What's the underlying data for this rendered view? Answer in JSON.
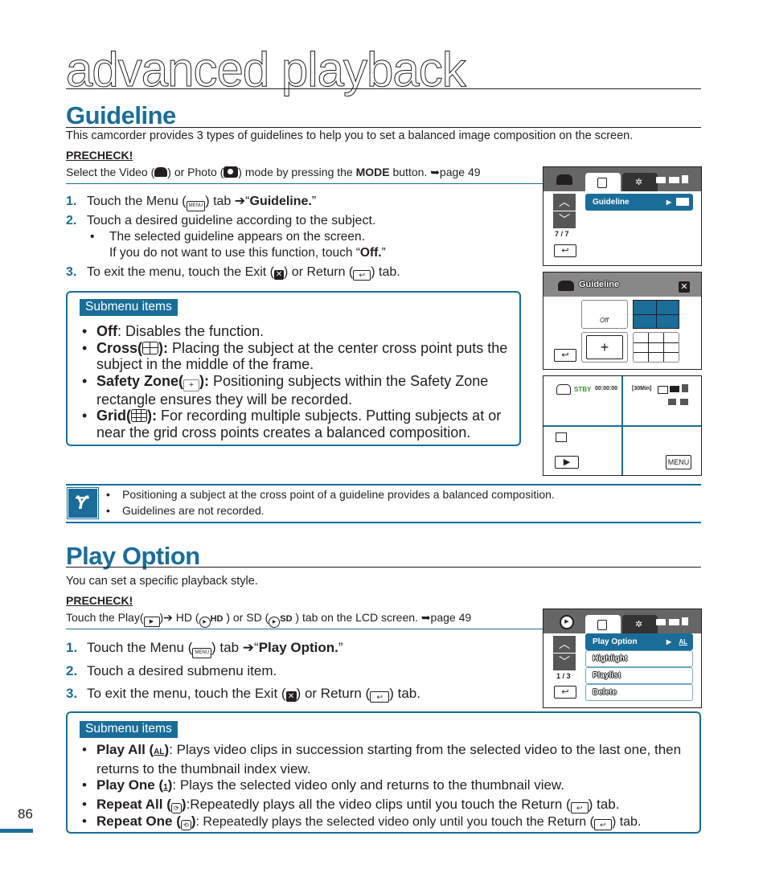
{
  "chapter": {
    "title": "advanced playback",
    "page_number": "86"
  },
  "colors": {
    "accent": "#1a6d99",
    "text": "#231f20",
    "stby_green": "#3a8f2e"
  },
  "guideline": {
    "title": "Guideline",
    "intro": "This camcorder provides 3 types of guidelines to help you to set a balanced image composition on the screen.",
    "precheck_label": "PRECHECK!",
    "precheck_text_1": "Select the Video (",
    "precheck_text_2": ") or Photo (",
    "precheck_text_3": ") mode by pressing the ",
    "precheck_mode": "MODE",
    "precheck_text_4": " button. ",
    "precheck_page": "➥page 49",
    "steps": [
      {
        "num": "1.",
        "pre": "Touch the Menu (",
        "icon": "MENU",
        "mid": ") tab ➔“",
        "bold": "Guideline.",
        "post": "”"
      },
      {
        "num": "2.",
        "text": "Touch a desired guideline according to the subject."
      },
      {
        "num": "3.",
        "pre": "To exit the menu, touch the Exit (",
        "mid": ") or Return (",
        "post": ") tab."
      }
    ],
    "step2_bullet_1": "The selected guideline appears on the screen.",
    "step2_bullet_2_pre": "If you do not want to use this function, touch “",
    "step2_bullet_2_bold": "Off.",
    "step2_bullet_2_post": "”",
    "submenu_label": "Submenu items",
    "submenu": [
      {
        "name": "Off",
        "desc": ": Disables the function."
      },
      {
        "name": "Cross(",
        "name_end": "):",
        "desc": " Placing the subject at the center cross point puts the subject in the middle of the frame."
      },
      {
        "name": "Safety Zone(",
        "name_end": "):",
        "desc": " Positioning subjects within the Safety Zone rectangle ensures they will be recorded."
      },
      {
        "name": "Grid(",
        "name_end": "):",
        "desc": " For recording multiple subjects. Putting subjects at or near the grid cross points creates a balanced composition."
      }
    ],
    "notes": [
      "Positioning a subject at the cross point of a guideline provides a balanced composition.",
      "Guidelines are not recorded."
    ],
    "screen1": {
      "menu_item": "Guideline",
      "page": "7 / 7"
    },
    "screen2": {
      "title": "Guideline",
      "off_label": "Off"
    },
    "screen3": {
      "stby": "STBY",
      "time": "00:00:00",
      "remaining": "[30Min]",
      "menu_button": "MENU"
    }
  },
  "play_option": {
    "title": "Play Option",
    "intro": "You can set a specific playback style.",
    "precheck_label": "PRECHECK!",
    "precheck_text_1": "Touch the Play(",
    "precheck_text_2": ")➔ HD (",
    "precheck_hd": "HD",
    "precheck_text_3": " ) or SD (",
    "precheck_sd": "SD",
    "precheck_text_4": " ) tab on the LCD screen. ",
    "precheck_page": "➥page 49",
    "steps": [
      {
        "num": "1.",
        "pre": "Touch the Menu (",
        "icon": "MENU",
        "mid": ") tab ➔“",
        "bold": "Play Option.",
        "post": "”"
      },
      {
        "num": "2.",
        "text": "Touch a desired submenu item."
      },
      {
        "num": "3.",
        "pre": "To exit the menu, touch the Exit (",
        "mid": ") or Return (",
        "post": ") tab."
      }
    ],
    "submenu_label": "Submenu items",
    "submenu": [
      {
        "name": "Play All (",
        "name_end": ")",
        "desc": ": Plays video clips in succession starting from the selected video to the last one, then returns to the thumbnail index view."
      },
      {
        "name": "Play One (",
        "name_end": ")",
        "desc": ": Plays the selected video only and returns to the thumbnail view."
      },
      {
        "name": "Repeat All (",
        "name_end": ")",
        "desc_pre": ":Repeatedly plays all the video clips until you touch the Return (",
        "desc_post": ") tab."
      },
      {
        "name": "Repeat One (",
        "name_end": ")",
        "desc_pre": ": Repeatedly plays the selected video only until you touch the Return (",
        "desc_post": ") tab."
      }
    ],
    "screen": {
      "menu_items": [
        "Play Option",
        "Highlight",
        "Playlist",
        "Delete"
      ],
      "page": "1 / 3",
      "selected_value_icon": "AL"
    }
  }
}
